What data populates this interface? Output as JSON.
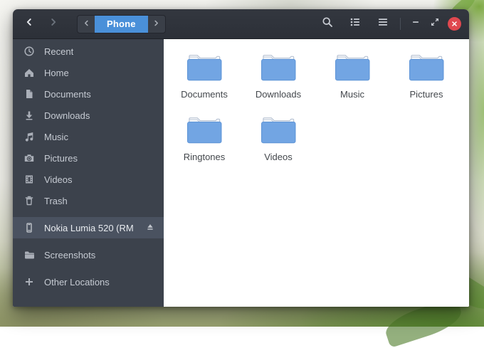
{
  "headerbar": {
    "pathbar": {
      "current_location": "Phone"
    },
    "tool_icons": [
      "search-icon",
      "list-view-icon",
      "menu-icon"
    ],
    "window_controls": [
      "minimize-icon",
      "restore-icon",
      "close-icon"
    ]
  },
  "sidebar": {
    "items": [
      {
        "label": "Recent",
        "icon": "clock-icon"
      },
      {
        "label": "Home",
        "icon": "home-icon"
      },
      {
        "label": "Documents",
        "icon": "document-icon"
      },
      {
        "label": "Downloads",
        "icon": "download-icon"
      },
      {
        "label": "Music",
        "icon": "music-note-icon"
      },
      {
        "label": "Pictures",
        "icon": "camera-icon"
      },
      {
        "label": "Videos",
        "icon": "film-icon"
      },
      {
        "label": "Trash",
        "icon": "trash-icon"
      },
      {
        "label": "Nokia Lumia 520 (RM …",
        "icon": "phone-icon",
        "selected": true,
        "eject": true,
        "section_gap": true
      },
      {
        "label": "Screenshots",
        "icon": "folder-icon",
        "section_gap": true
      },
      {
        "label": "Other Locations",
        "icon": "plus-icon",
        "section_gap": true
      }
    ]
  },
  "content": {
    "folders": [
      {
        "name": "Documents"
      },
      {
        "name": "Downloads"
      },
      {
        "name": "Music"
      },
      {
        "name": "Pictures"
      },
      {
        "name": "Ringtones"
      },
      {
        "name": "Videos"
      }
    ]
  },
  "colors": {
    "accent_blue": "#4a90d9",
    "folder_blue": "#72a5e3",
    "headerbar_dark": "#2e323a",
    "sidebar_dark": "#3c424c",
    "close_red": "#e0484f"
  }
}
